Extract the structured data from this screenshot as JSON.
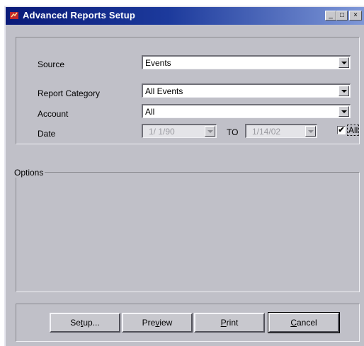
{
  "window": {
    "title": "Advanced Reports Setup"
  },
  "controls": {
    "minimize": "_",
    "maximize": "□",
    "close": "×"
  },
  "form": {
    "source": {
      "label": "Source",
      "value": "Events"
    },
    "category": {
      "label": "Report Category",
      "value": "All Events"
    },
    "account": {
      "label": "Account",
      "value": "All"
    },
    "date": {
      "label": "Date",
      "from": "1/ 1/90",
      "to_label": "TO",
      "to": "1/14/02",
      "all_label": "All",
      "all_checked": "✔"
    }
  },
  "options": {
    "title": "Options"
  },
  "buttons": {
    "setup": {
      "pre": "Se",
      "u": "t",
      "post": "up..."
    },
    "preview": {
      "pre": "Pre",
      "u": "v",
      "post": "iew"
    },
    "print": {
      "pre": "",
      "u": "P",
      "post": "rint"
    },
    "cancel": {
      "pre": "",
      "u": "C",
      "post": "ancel"
    }
  },
  "colors": {
    "title_start": "#0a1a78",
    "title_end": "#7f98d8",
    "dialog_bg": "#c0c0c8"
  }
}
